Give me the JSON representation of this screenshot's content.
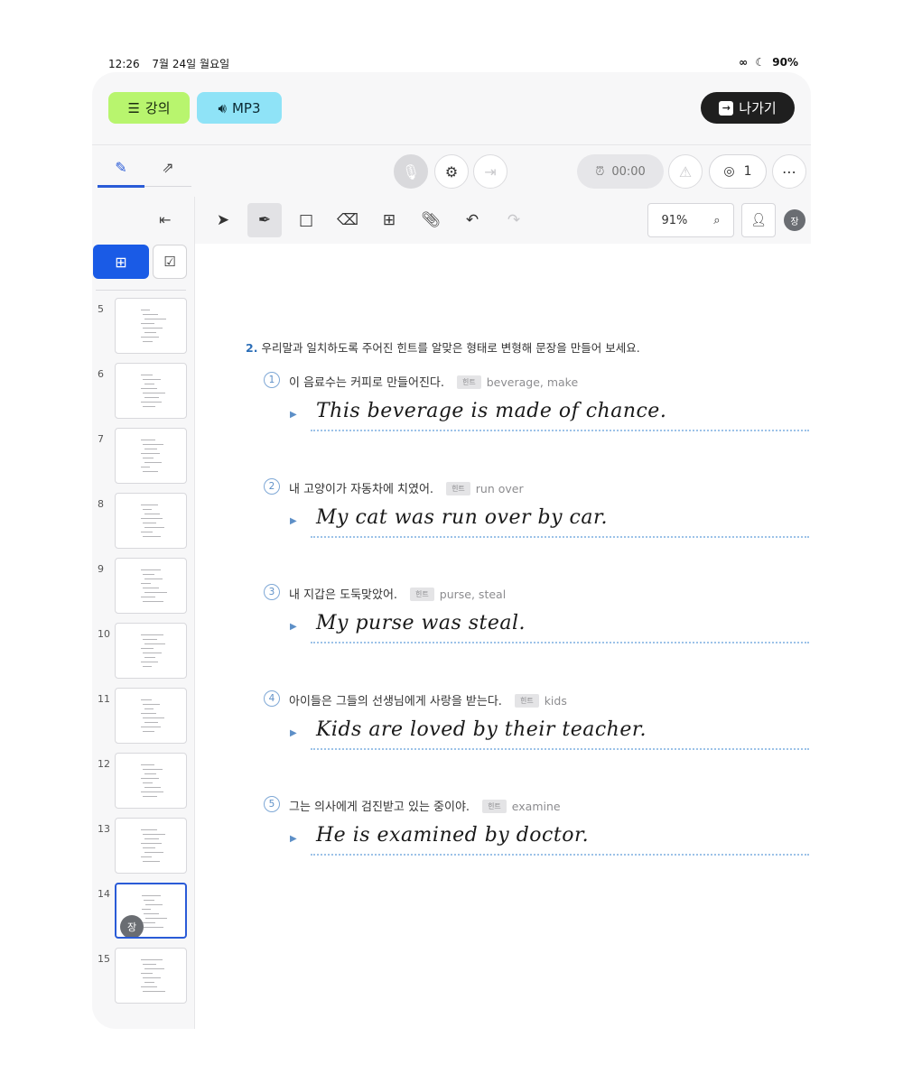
{
  "status_bar": {
    "time": "12:26",
    "date": "7월 24일 월요일",
    "battery": "90%"
  },
  "header": {
    "lecture_label": "강의",
    "mp3_label": "MP3",
    "exit_label": "나가기"
  },
  "controls": {
    "timer": "00:00",
    "user_count": "1"
  },
  "toolbar": {
    "zoom": "91%",
    "avatar_initial": "장"
  },
  "sidebar": {
    "pages": [
      {
        "num": "5"
      },
      {
        "num": "6"
      },
      {
        "num": "7"
      },
      {
        "num": "8"
      },
      {
        "num": "9"
      },
      {
        "num": "10"
      },
      {
        "num": "11"
      },
      {
        "num": "12"
      },
      {
        "num": "13"
      },
      {
        "num": "14",
        "active": true
      },
      {
        "num": "15"
      }
    ],
    "active_avatar": "장"
  },
  "document": {
    "question_number": "2.",
    "question_text": "우리말과 일치하도록 주어진 힌트를 알맞은 형태로 변형해 문장을 만들어 보세요.",
    "hint_tag": "힌트",
    "items": [
      {
        "num": "1",
        "korean": "이 음료수는 커피로 만들어진다.",
        "hint": "beverage, make",
        "answer": "This beverage is made of chance."
      },
      {
        "num": "2",
        "korean": "내 고양이가 자동차에 치였어.",
        "hint": "run over",
        "answer": "My cat was run over by car."
      },
      {
        "num": "3",
        "korean": "내 지갑은 도둑맞았어.",
        "hint": "purse, steal",
        "answer": "My purse was steal."
      },
      {
        "num": "4",
        "korean": "아이들은 그들의 선생님에게 사랑을 받는다.",
        "hint": "kids",
        "answer": "Kids are loved by their teacher."
      },
      {
        "num": "5",
        "korean": "그는 의사에게 검진받고 있는 중이야.",
        "hint": "examine",
        "answer": "He is examined by doctor."
      }
    ]
  },
  "colors": {
    "accent_blue": "#1a5be6",
    "lecture_green": "#b8f56e",
    "mp3_cyan": "#8fe3f7",
    "exit_dark": "#1f1f1f"
  },
  "icons": [
    "lecture-list-icon",
    "speaker-icon",
    "exit-icon",
    "pen-tab-icon",
    "share-tab-icon",
    "mic-off-icon",
    "gear-icon",
    "enter-icon",
    "alarm-icon",
    "siren-icon",
    "user-icon",
    "chat-icon",
    "collapse-icon",
    "add-page-icon",
    "check-icon",
    "pointer-icon",
    "pen-icon",
    "rectangle-icon",
    "eraser-icon",
    "add-box-icon",
    "attach-icon",
    "undo-icon",
    "redo-icon",
    "search-icon",
    "speaking-user-icon"
  ]
}
